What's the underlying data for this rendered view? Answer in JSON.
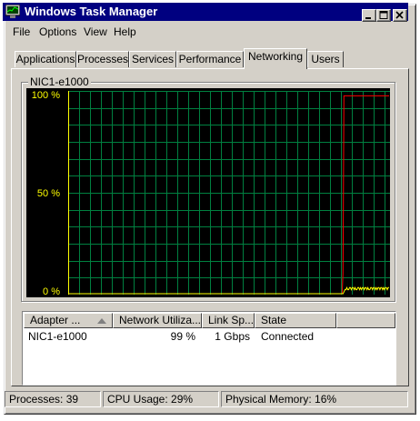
{
  "window": {
    "title": "Windows Task Manager"
  },
  "menu": [
    {
      "label": "File"
    },
    {
      "label": "Options"
    },
    {
      "label": "View"
    },
    {
      "label": "Help"
    }
  ],
  "tabs": [
    {
      "label": "Applications"
    },
    {
      "label": "Processes"
    },
    {
      "label": "Services"
    },
    {
      "label": "Performance"
    },
    {
      "label": "Networking"
    },
    {
      "label": "Users"
    }
  ],
  "graph": {
    "label": "NIC1-e1000",
    "y_labels": [
      "100 %",
      "50 %",
      "0 %"
    ],
    "colors": {
      "background": "#000000",
      "grid": "#008040",
      "total": "#ff0000",
      "received": "#ffff00",
      "axis": "#ffff00"
    },
    "chart_data": {
      "type": "line",
      "ylim": [
        0,
        100
      ],
      "y_ticks": [
        "100 %",
        "50 %",
        "0 %"
      ],
      "series": [
        {
          "color": "#ff0000",
          "values": [
            0,
            0,
            0,
            0,
            0,
            0,
            0,
            0,
            0,
            0,
            0,
            0,
            0,
            0,
            0,
            0,
            0,
            0,
            0,
            0,
            0,
            0,
            0,
            0,
            0,
            0,
            0,
            0,
            0,
            0,
            0,
            0,
            0,
            0,
            0,
            0,
            0,
            0,
            0,
            0,
            0,
            0,
            0,
            0,
            0,
            0,
            0,
            0,
            0,
            0,
            0,
            0,
            0,
            0,
            0,
            0,
            0,
            0,
            0,
            0,
            0,
            0,
            0,
            0,
            0,
            0,
            0,
            0,
            0,
            0,
            0,
            0,
            0,
            0,
            0,
            0,
            0,
            0,
            0,
            0,
            0,
            0,
            0,
            0,
            0,
            0,
            0,
            0,
            0,
            0,
            0,
            0,
            0,
            0,
            0,
            0,
            0,
            0,
            0,
            0,
            0,
            0,
            0,
            0,
            0,
            0,
            0,
            0,
            0,
            0,
            0,
            0,
            0,
            0,
            0,
            0,
            0,
            0,
            0,
            0,
            0,
            0,
            0,
            0,
            0,
            0,
            0,
            0,
            0,
            0,
            0,
            0,
            0,
            0,
            0,
            0,
            0,
            0,
            0,
            0,
            0,
            0,
            0,
            0,
            0,
            0,
            0,
            0,
            0,
            0,
            0,
            0,
            0,
            0,
            0,
            0,
            0,
            0,
            0,
            0,
            0,
            0,
            0,
            0,
            0,
            0,
            0,
            0,
            0,
            0,
            0,
            0,
            0,
            0,
            0,
            0,
            0,
            0,
            0,
            0,
            0,
            0,
            0,
            0,
            0,
            0,
            0,
            0,
            0,
            0,
            0,
            0,
            0,
            0,
            0,
            0,
            0,
            0,
            0,
            0,
            0,
            0,
            0,
            0,
            0,
            0,
            0,
            0,
            0,
            0,
            0,
            0,
            0,
            0,
            0,
            0,
            0,
            0,
            0,
            0,
            0,
            0,
            0,
            0,
            0,
            0,
            0,
            0,
            0,
            0,
            0,
            0,
            0,
            0,
            0,
            0,
            0,
            0,
            0,
            0,
            0,
            0,
            0,
            0,
            0,
            0,
            0,
            0,
            0,
            0,
            0,
            0,
            0,
            0,
            0,
            0,
            0,
            0,
            0,
            0,
            0,
            0,
            0,
            0,
            0,
            0,
            0,
            0,
            0,
            0,
            0,
            0,
            0,
            0,
            0,
            0,
            0,
            0,
            0,
            0,
            0,
            0,
            0,
            0,
            0,
            0,
            0,
            0,
            0,
            0,
            0,
            0,
            0,
            0,
            0,
            0,
            0,
            10,
            98,
            98,
            98,
            98,
            98,
            98,
            98,
            98,
            98,
            98,
            98,
            98,
            98,
            98,
            98,
            98,
            98,
            98,
            98,
            98,
            98,
            98,
            98,
            98,
            98,
            98,
            98,
            98,
            98,
            98,
            98,
            98,
            98,
            98,
            98,
            98,
            98,
            98,
            98,
            98,
            98,
            98,
            98,
            98,
            98,
            98,
            98,
            98,
            98,
            98
          ]
        },
        {
          "color": "#ffff00",
          "values": [
            0,
            0,
            0,
            0,
            0,
            0,
            0,
            0,
            0,
            0,
            0,
            0,
            0,
            0,
            0,
            0,
            0,
            0,
            0,
            0,
            0,
            0,
            0,
            0,
            0,
            0,
            0,
            0,
            0,
            0,
            0,
            0,
            0,
            0,
            0,
            0,
            0,
            0,
            0,
            0,
            0,
            0,
            0,
            0,
            0,
            0,
            0,
            0,
            0,
            0,
            0,
            0,
            0,
            0,
            0,
            0,
            0,
            0,
            0,
            0,
            0,
            0,
            0,
            0,
            0,
            0,
            0,
            0,
            0,
            0,
            0,
            0,
            0,
            0,
            0,
            0,
            0,
            0,
            0,
            0,
            0,
            0,
            0,
            0,
            0,
            0,
            0,
            0,
            0,
            0,
            0,
            0,
            0,
            0,
            0,
            0,
            0,
            0,
            0,
            0,
            0,
            0,
            0,
            0,
            0,
            0,
            0,
            0,
            0,
            0,
            0,
            0,
            0,
            0,
            0,
            0,
            0,
            0,
            0,
            0,
            0,
            0,
            0,
            0,
            0,
            0,
            0,
            0,
            0,
            0,
            0,
            0,
            0,
            0,
            0,
            0,
            0,
            0,
            0,
            0,
            0,
            0,
            0,
            0,
            0,
            0,
            0,
            0,
            0,
            0,
            0,
            0,
            0,
            0,
            0,
            0,
            0,
            0,
            0,
            0,
            0,
            0,
            0,
            0,
            0,
            0,
            0,
            0,
            0,
            0,
            0,
            0,
            0,
            0,
            0,
            0,
            0,
            0,
            0,
            0,
            0,
            0,
            0,
            0,
            0,
            0,
            0,
            0,
            0,
            0,
            0,
            0,
            0,
            0,
            0,
            0,
            0,
            0,
            0,
            0,
            0,
            0,
            0,
            0,
            0,
            0,
            0,
            0,
            0,
            0,
            0,
            0,
            0,
            0,
            0,
            0,
            0,
            0,
            0,
            0,
            0,
            0,
            0,
            0,
            0,
            0,
            0,
            0,
            0,
            0,
            0,
            0,
            0,
            0,
            0,
            0,
            0,
            0,
            0,
            0,
            0,
            0,
            0,
            0,
            0,
            0,
            0,
            0,
            0,
            0,
            0,
            0,
            0,
            0,
            0,
            0,
            0,
            0,
            0,
            0,
            0,
            0,
            0,
            0,
            0,
            0,
            0,
            0,
            0,
            0,
            0,
            0,
            0,
            0,
            0,
            0,
            0,
            0,
            0,
            0,
            0,
            0,
            0,
            0,
            0,
            0,
            0,
            0,
            0,
            0,
            0,
            0,
            0,
            0,
            0,
            0,
            0,
            0,
            0,
            1,
            2,
            2,
            3,
            2,
            2,
            3,
            3,
            2,
            3,
            3,
            2,
            3,
            2,
            2,
            3,
            3,
            2,
            3,
            2,
            3,
            3,
            2,
            3,
            3,
            2,
            3,
            2,
            2,
            3,
            3,
            2,
            3,
            3,
            2,
            3,
            2,
            3,
            3,
            2,
            3,
            3,
            2,
            3,
            2,
            3,
            3,
            2,
            3,
            3
          ]
        }
      ]
    }
  },
  "adapters": {
    "columns": [
      "Adapter ...",
      "Network Utiliza...",
      "Link Sp...",
      "State"
    ],
    "rows": [
      {
        "name": "NIC1-e1000",
        "utilization": "99 %",
        "speed": "1 Gbps",
        "state": "Connected"
      }
    ]
  },
  "status": {
    "processes": "Processes: 39",
    "cpu": "CPU Usage: 29%",
    "memory": "Physical Memory: 16%"
  }
}
